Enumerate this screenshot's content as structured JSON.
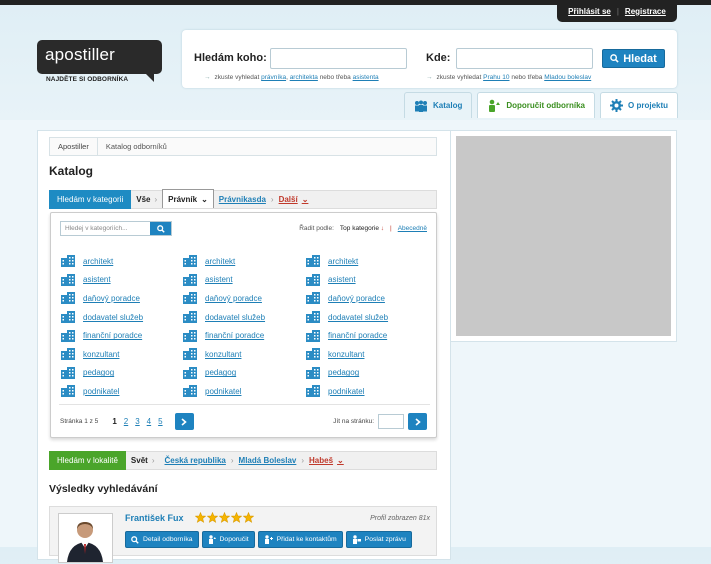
{
  "header": {
    "login": "Přihlásit se",
    "register": "Registrace",
    "logo": "apostiller",
    "slogan": "NAJDĚTE SI ODBORNÍKA"
  },
  "search": {
    "who_label": "Hledám koho:",
    "where_label": "Kde:",
    "button": "Hledat",
    "who_hint_prefix": "zkuste vyhledat",
    "who_hint_a": "právníka",
    "who_hint_b": "architekta",
    "who_hint_mid": "nebo třeba",
    "who_hint_c": "asistenta",
    "where_hint_prefix": "zkuste vyhledat",
    "where_hint_a": "Prahu 10",
    "where_hint_mid": "nebo třeba",
    "where_hint_b": "Mladou boleslav"
  },
  "tabs": [
    {
      "label": "Katalog",
      "icon": "people-icon"
    },
    {
      "label": "Doporučit odborníka",
      "icon": "recommend-icon"
    },
    {
      "label": "O projektu",
      "icon": "gear-icon"
    }
  ],
  "breadcrumb": [
    "Apostiller",
    "Katalog odborníků"
  ],
  "page_title": "Katalog",
  "category_filter": {
    "label": "Hledám v kategorii",
    "items": [
      "Vše",
      "Právník",
      "Právnikasda",
      "Další"
    ]
  },
  "panel": {
    "search_placeholder": "Hledej v kategoriích...",
    "sort_label": "Řadit podle:",
    "sort_current": "Top kategorie",
    "sort_alt": "Abecedně",
    "categories": [
      "architekt",
      "asistent",
      "daňový poradce",
      "dodavatel služeb",
      "finanční poradce",
      "konzultant",
      "pedagog",
      "podnikatel"
    ],
    "page_info": "Stránka 1 z 5",
    "pages": [
      "1",
      "2",
      "3",
      "4",
      "5"
    ],
    "jump_label": "Jít na stránku:"
  },
  "location_filter": {
    "label": "Hledám v lokalitě",
    "items": [
      "Svět",
      "Česká republika",
      "Mladá Boleslav",
      "Habeš"
    ]
  },
  "results_title": "Výsledky vyhledávání",
  "result": {
    "name": "František Fux",
    "rating": 5,
    "views": "Profil zobrazen 81x",
    "buttons": [
      "Detail odborníka",
      "Doporučit",
      "Přidat ke kontaktům",
      "Poslat zprávu"
    ]
  },
  "colors": {
    "accent": "#1e83c0",
    "green": "#4aa52a",
    "red": "#c0392b"
  }
}
